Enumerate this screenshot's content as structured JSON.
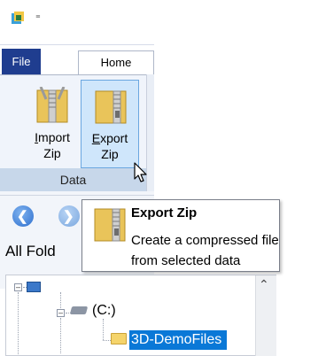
{
  "qat": {
    "app_icon": "app-icon",
    "customize_glyph": "⁼"
  },
  "ribbon": {
    "tabs": [
      {
        "label": "File",
        "selected": false
      },
      {
        "label": "Home",
        "selected": true
      }
    ],
    "buttons": [
      {
        "line1": "Import",
        "line2": "Zip",
        "icon": "zip-import-icon"
      },
      {
        "line1": "Export",
        "line2": "Zip",
        "icon": "zip-export-icon",
        "hovered": true
      }
    ],
    "group_label": "Data"
  },
  "navigation": {
    "back_icon": "back-arrow-icon",
    "forward_icon": "forward-arrow-icon",
    "panel_title": "All Fold"
  },
  "tree": {
    "drive_label": "(C:)",
    "selected_folder": "3D-DemoFiles"
  },
  "tooltip": {
    "title": "Export Zip",
    "line1": "Create a compressed file",
    "line2": "from selected data"
  },
  "colors": {
    "file_tab": "#1f3d8f",
    "hover_bg": "#cfe6fb",
    "hover_border": "#6aa7e0",
    "group_label_bg": "#c7d7ea",
    "selection": "#0a78d7"
  }
}
